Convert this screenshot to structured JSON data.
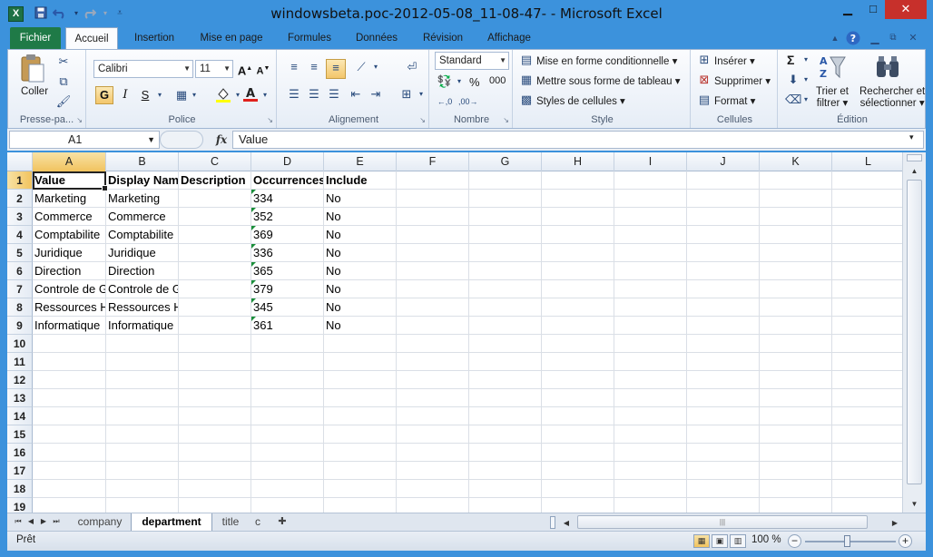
{
  "window": {
    "title": "windowsbeta.poc-2012-05-08_11-08-47-  -  Microsoft Excel",
    "app_logo": "X",
    "minimize": "▁",
    "maximize": "□",
    "close": "✕"
  },
  "qat": {
    "save_icon": "save-icon",
    "undo_icon": "undo-icon",
    "redo_icon": "redo-icon",
    "customize_icon": "customize-icon"
  },
  "tabs": [
    {
      "label": "Fichier"
    },
    {
      "label": "Accueil"
    },
    {
      "label": "Insertion"
    },
    {
      "label": "Mise en page"
    },
    {
      "label": "Formules"
    },
    {
      "label": "Données"
    },
    {
      "label": "Révision"
    },
    {
      "label": "Affichage"
    }
  ],
  "ribbon": {
    "clipboard": {
      "group": "Presse-pa...",
      "paste": "Coller"
    },
    "font": {
      "group": "Police",
      "name": "Calibri",
      "size": "11",
      "bold": "G",
      "italic": "I",
      "underline": "S"
    },
    "alignment": {
      "group": "Alignement"
    },
    "number": {
      "group": "Nombre",
      "format": "Standard",
      "percent": "%",
      "thousands": "000"
    },
    "style": {
      "group": "Style",
      "conditional": "Mise en forme conditionnelle",
      "table": "Mettre sous forme de tableau",
      "cell_styles": "Styles de cellules"
    },
    "cells": {
      "group": "Cellules",
      "insert": "Insérer",
      "delete": "Supprimer",
      "format": "Format"
    },
    "editing": {
      "group": "Édition",
      "sum": "Σ",
      "sort_l1": "Trier et",
      "sort_l2": "filtrer",
      "find_l1": "Rechercher et",
      "find_l2": "sélectionner"
    }
  },
  "formula_bar": {
    "name_box": "A1",
    "fx": "fx",
    "value": "Value"
  },
  "grid": {
    "columns": [
      "A",
      "B",
      "C",
      "D",
      "E",
      "F",
      "G",
      "H",
      "I",
      "J",
      "K",
      "L"
    ],
    "rows": [
      "1",
      "2",
      "3",
      "4",
      "5",
      "6",
      "7",
      "8",
      "9",
      "10",
      "11",
      "12",
      "13",
      "14",
      "15",
      "16",
      "17",
      "18",
      "19"
    ],
    "cells": [
      [
        "Value",
        "Display Nam",
        "Description",
        "Occurrences",
        "Include"
      ],
      [
        "Marketing",
        "Marketing",
        "",
        "334",
        "No"
      ],
      [
        "Commerce",
        "Commerce",
        "",
        "352",
        "No"
      ],
      [
        "Comptabilite",
        "Comptabilite",
        "",
        "369",
        "No"
      ],
      [
        "Juridique",
        "Juridique",
        "",
        "336",
        "No"
      ],
      [
        "Direction",
        "Direction",
        "",
        "365",
        "No"
      ],
      [
        "Controle de G",
        "Controle de Gestion",
        "",
        "379",
        "No"
      ],
      [
        "Ressources H",
        "Ressources Humaines",
        "",
        "345",
        "No"
      ],
      [
        "Informatique",
        "Informatique",
        "",
        "361",
        "No"
      ]
    ]
  },
  "sheets": [
    {
      "label": "company"
    },
    {
      "label": "department"
    },
    {
      "label": "title"
    },
    {
      "label": "c"
    }
  ],
  "status": {
    "ready": "Prêt",
    "zoom": "100 %",
    "zoom_minus": "−",
    "zoom_plus": "+"
  }
}
